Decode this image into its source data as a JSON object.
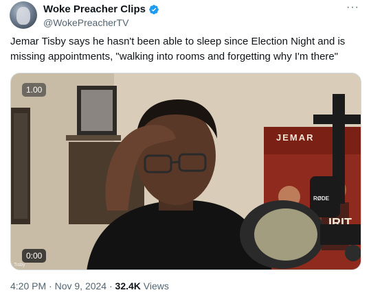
{
  "author": {
    "display_name": "Woke Preacher Clips",
    "handle": "@WokePreacherTV"
  },
  "tweet": {
    "text": "Jemar Tisby says he hasn't been able to sleep since Election Night and is missing appointments, \"walking into rooms and forgetting why I'm there\""
  },
  "video": {
    "playback_rate": "1.00",
    "elapsed": "0:00",
    "watermark": "Tisby",
    "poster_text_1": "JEMAR",
    "poster_text_2": "IRIT",
    "mic_brand": "RØDE"
  },
  "meta": {
    "time": "4:20 PM",
    "date": "Nov 9, 2024",
    "views_count": "32.4K",
    "views_label": "Views",
    "separator": "·"
  },
  "colors": {
    "text_primary": "#0f1419",
    "text_secondary": "#536471",
    "verified_blue": "#1d9bf0"
  },
  "icons": {
    "verified": "verified-badge-icon",
    "more": "more-options-icon"
  },
  "more_glyph": "···"
}
